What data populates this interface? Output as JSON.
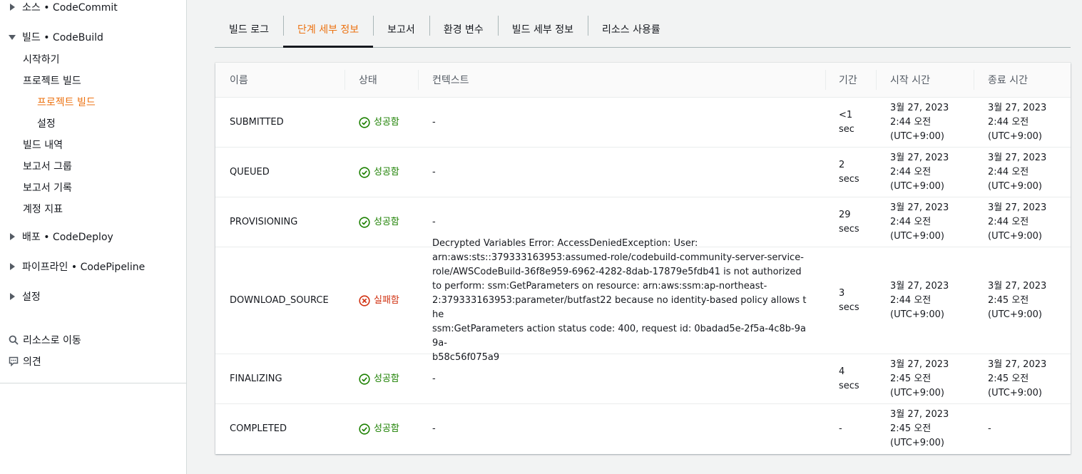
{
  "sidebar": {
    "source": {
      "label": "소스",
      "service": "• CodeCommit"
    },
    "build": {
      "label": "빌드",
      "service": "• CodeBuild"
    },
    "build_items": {
      "getting_started": "시작하기",
      "build_projects": "프로젝트 빌드",
      "build_projects_sub": "프로젝트 빌드",
      "settings_sub": "설정",
      "build_history": "빌드 내역",
      "report_groups": "보고서 그룹",
      "report_history": "보고서 기록",
      "account_metrics": "계정 지표"
    },
    "deploy": {
      "label": "배포",
      "service": "• CodeDeploy"
    },
    "pipeline": {
      "label": "파이프라인",
      "service": "• CodePipeline"
    },
    "settings": {
      "label": "설정"
    },
    "go_to_resource": "리소스로 이동",
    "feedback": "의견"
  },
  "tabs": [
    {
      "label": "빌드 로그",
      "active": false
    },
    {
      "label": "단계 세부 정보",
      "active": true
    },
    {
      "label": "보고서",
      "active": false
    },
    {
      "label": "환경 변수",
      "active": false
    },
    {
      "label": "빌드 세부 정보",
      "active": false
    },
    {
      "label": "리소스 사용률",
      "active": false
    }
  ],
  "table": {
    "columns": {
      "name": "이름",
      "status": "상태",
      "context": "컨텍스트",
      "duration": "기간",
      "start_time": "시작 시간",
      "end_time": "종료 시간"
    },
    "rows": [
      {
        "name": "SUBMITTED",
        "status": "성공함",
        "status_type": "success",
        "context": "-",
        "duration_value": "<1",
        "duration_unit": "sec",
        "start_date": "3월 27, 2023",
        "start_time": "2:44 오전",
        "start_tz": "(UTC+9:00)",
        "end_date": "3월 27, 2023",
        "end_time": "2:44 오전",
        "end_tz": "(UTC+9:00)"
      },
      {
        "name": "QUEUED",
        "status": "성공함",
        "status_type": "success",
        "context": "-",
        "duration_value": "2",
        "duration_unit": "secs",
        "start_date": "3월 27, 2023",
        "start_time": "2:44 오전",
        "start_tz": "(UTC+9:00)",
        "end_date": "3월 27, 2023",
        "end_time": "2:44 오전",
        "end_tz": "(UTC+9:00)"
      },
      {
        "name": "PROVISIONING",
        "status": "성공함",
        "status_type": "success",
        "context": "-",
        "duration_value": "29",
        "duration_unit": "secs",
        "start_date": "3월 27, 2023",
        "start_time": "2:44 오전",
        "start_tz": "(UTC+9:00)",
        "end_date": "3월 27, 2023",
        "end_time": "2:44 오전",
        "end_tz": "(UTC+9:00)"
      },
      {
        "name": "DOWNLOAD_SOURCE",
        "status": "실패함",
        "status_type": "error",
        "context_lines": [
          "Decrypted Variables Error: AccessDeniedException: User:",
          "arn:aws:sts::379333163953:assumed-role/codebuild-community-server-service-",
          "role/AWSCodeBuild-36f8e959-6962-4282-8dab-17879e5fdb41 is not authorized",
          "to perform: ssm:GetParameters on resource: arn:aws:ssm:ap-northeast-",
          "2:379333163953:parameter/butfast22 because no identity-based policy allows the",
          "ssm:GetParameters action status code: 400, request id: 0badad5e-2f5a-4c8b-9a9a-",
          "b58c56f075a9"
        ],
        "duration_value": "3",
        "duration_unit": "secs",
        "start_date": "3월 27, 2023",
        "start_time": "2:44 오전",
        "start_tz": "(UTC+9:00)",
        "end_date": "3월 27, 2023",
        "end_time": "2:45 오전",
        "end_tz": "(UTC+9:00)"
      },
      {
        "name": "FINALIZING",
        "status": "성공함",
        "status_type": "success",
        "context": "-",
        "duration_value": "4",
        "duration_unit": "secs",
        "start_date": "3월 27, 2023",
        "start_time": "2:45 오전",
        "start_tz": "(UTC+9:00)",
        "end_date": "3월 27, 2023",
        "end_time": "2:45 오전",
        "end_tz": "(UTC+9:00)"
      },
      {
        "name": "COMPLETED",
        "status": "성공함",
        "status_type": "success",
        "context": "-",
        "duration_value": "-",
        "start_date": "3월 27, 2023",
        "start_time": "2:45 오전",
        "start_tz": "(UTC+9:00)",
        "end_single": "-"
      }
    ]
  },
  "colors": {
    "accent": "#ec7211",
    "success": "#1d8102",
    "error": "#d13212",
    "text": "#16191f",
    "muted": "#545b64"
  },
  "icons": {
    "success": "check-circle-icon",
    "error": "x-circle-icon",
    "search": "search-icon",
    "feedback": "feedback-icon",
    "expand": "caret-right-icon",
    "collapse": "caret-down-icon"
  }
}
